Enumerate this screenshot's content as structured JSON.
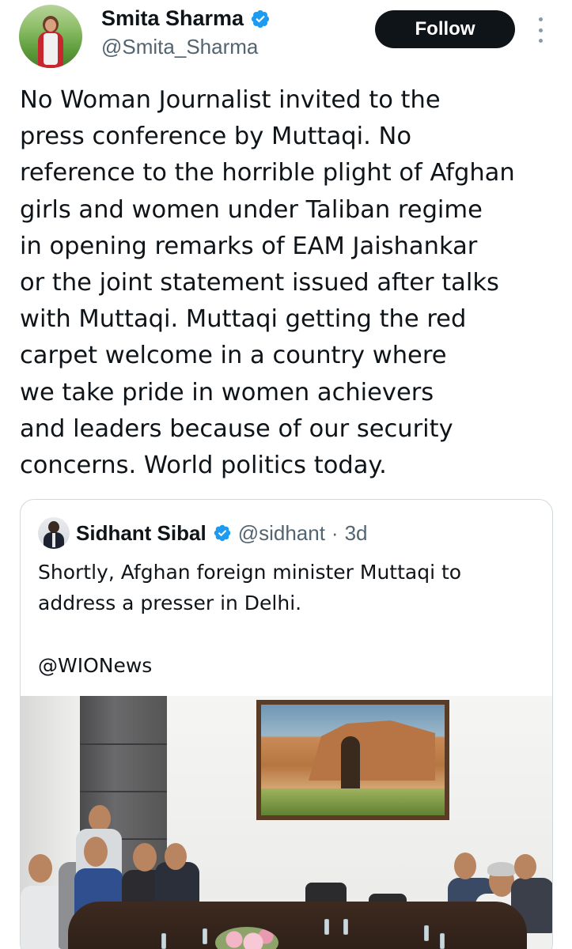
{
  "tweet": {
    "author": {
      "display_name": "Smita Sharma",
      "handle": "@Smita_Sharma",
      "verified": true
    },
    "follow_label": "Follow",
    "more_icon": "more-vertical-icon",
    "text": "No Woman Journalist invited to the\npress conference by Muttaqi. No\nreference to the horrible plight of Afghan\ngirls and women under Taliban regime\nin opening remarks of EAM Jaishankar\nor the joint statement issued after talks\nwith Muttaqi. Muttaqi getting the red\ncarpet welcome in a country where\nwe take pride in women achievers\nand leaders because of our security\nconcerns.  World politics today."
  },
  "quote": {
    "author": {
      "display_name": "Sidhant Sibal",
      "handle": "@sidhant",
      "time": "3d",
      "separator": "·",
      "verified": true
    },
    "text": "Shortly, Afghan foreign minister Muttaqi to\naddress a presser in Delhi.",
    "mention": "@WIONews",
    "media": "conference-room-photo"
  },
  "colors": {
    "text_primary": "#0f1419",
    "text_secondary": "#536471",
    "follow_bg": "#0f1419",
    "verified_blue": "#1d9bf0",
    "border": "#cfd9de"
  }
}
